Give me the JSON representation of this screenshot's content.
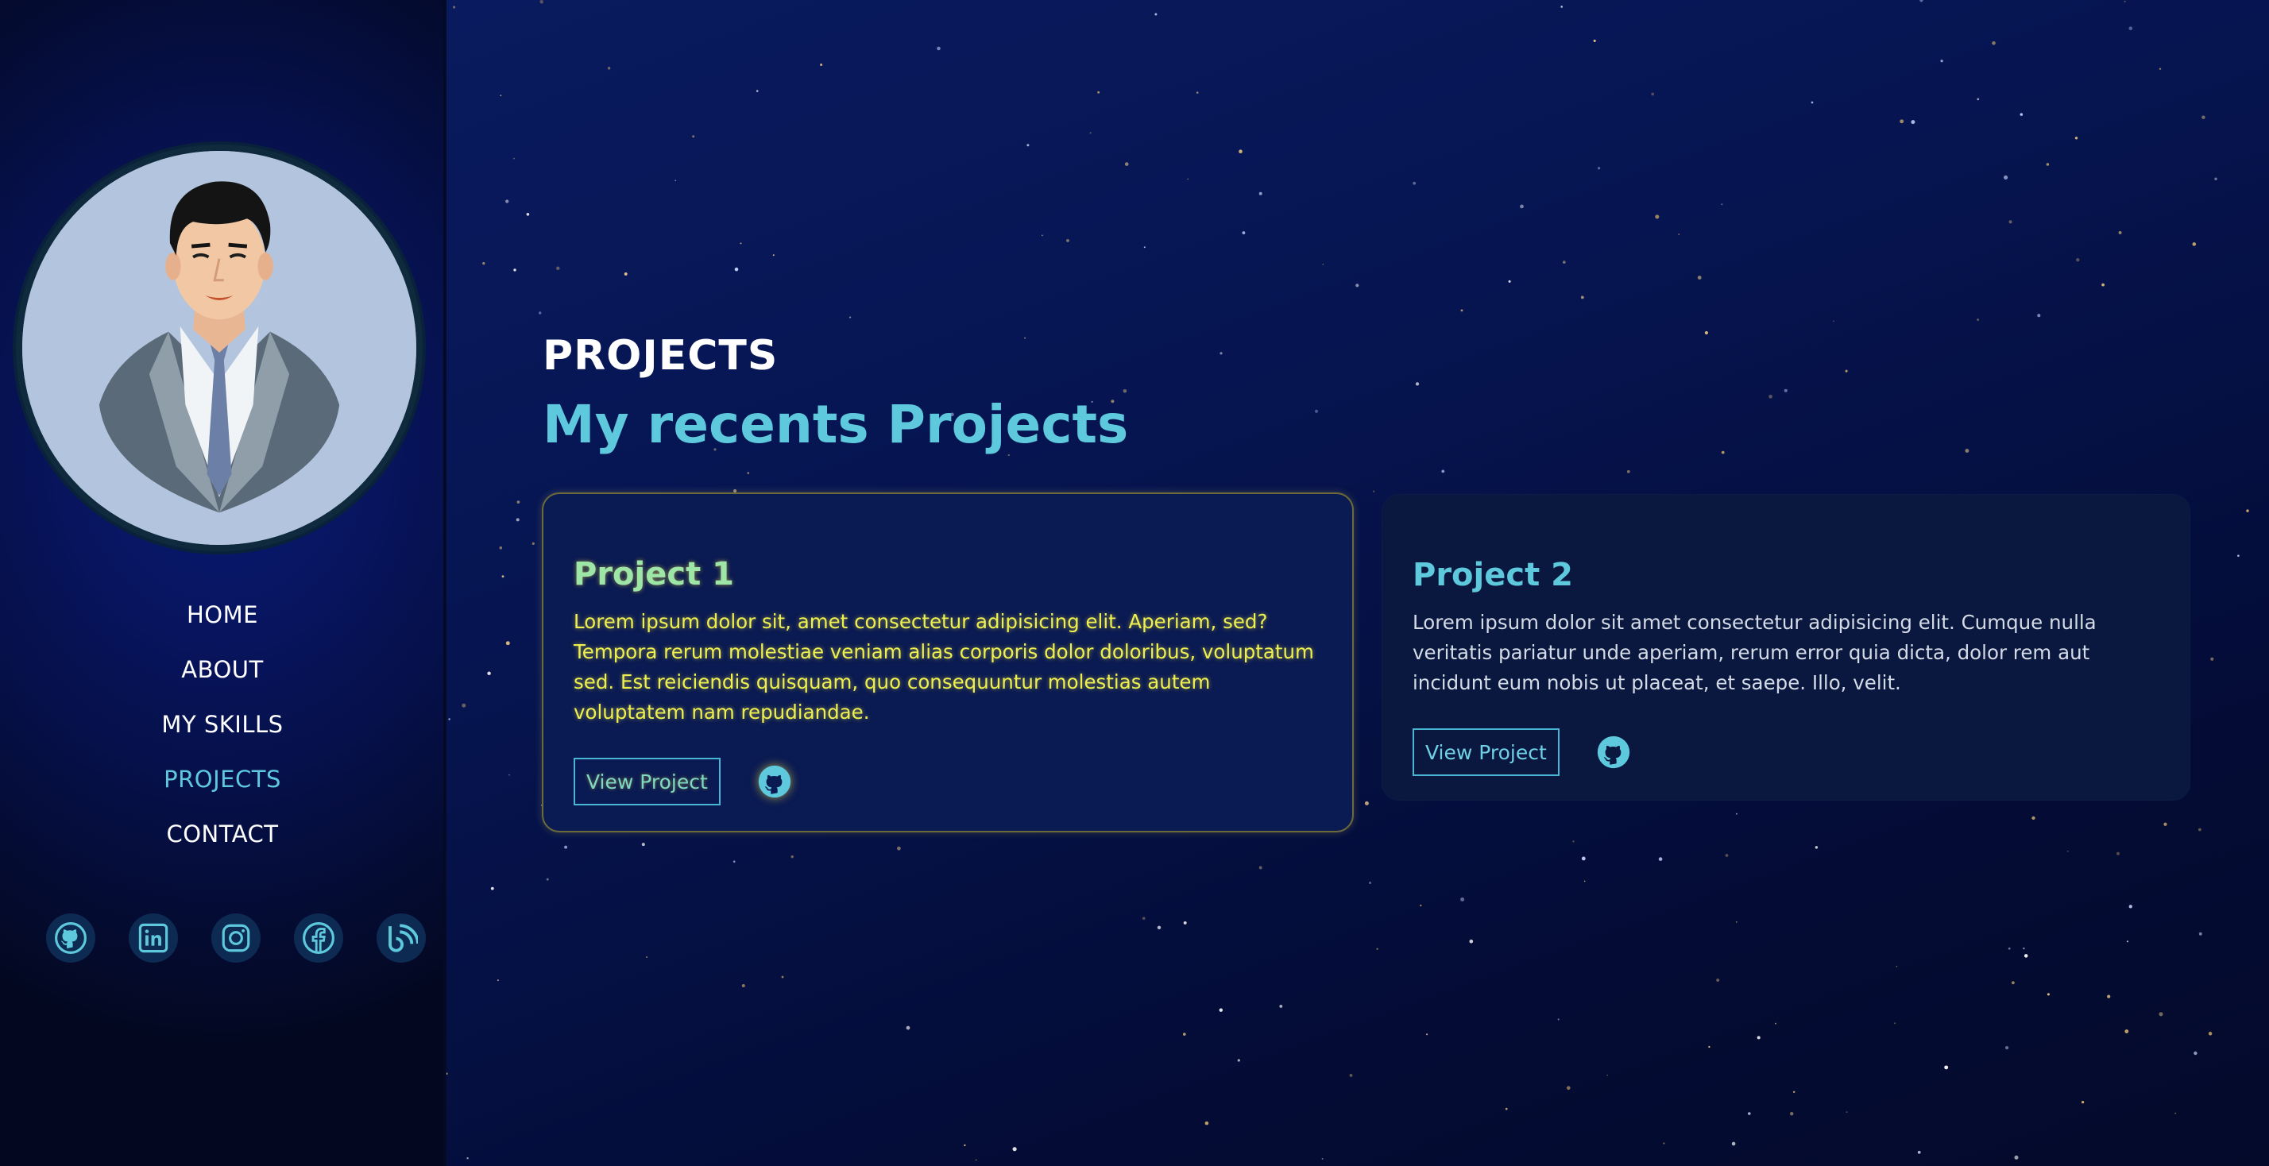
{
  "sidebar": {
    "nav": [
      {
        "label": "HOME"
      },
      {
        "label": "ABOUT"
      },
      {
        "label": "MY SKILLS"
      },
      {
        "label": "PROJECTS",
        "active": true
      },
      {
        "label": "CONTACT"
      }
    ],
    "socials": [
      {
        "icon": "github-icon"
      },
      {
        "icon": "linkedin-icon"
      },
      {
        "icon": "instagram-icon"
      },
      {
        "icon": "facebook-icon"
      },
      {
        "icon": "blog-icon"
      }
    ]
  },
  "main": {
    "kicker": "PROJECTS",
    "title": "My recents Projects",
    "projects": [
      {
        "title": "Project 1",
        "description": "Lorem ipsum dolor sit, amet consectetur adipisicing elit. Aperiam, sed? Tempora rerum molestiae veniam alias corporis dolor doloribus, voluptatum sed. Est reiciendis quisquam, quo consequuntur molestias autem voluptatem nam repudiandae.",
        "button_label": "View Project",
        "repo_icon": "github-icon"
      },
      {
        "title": "Project 2",
        "description": "Lorem ipsum dolor sit amet consectetur adipisicing elit. Cumque nulla veritatis pariatur unde aperiam, rerum error quia dicta, dolor rem aut incidunt eum nobis ut placeat, et saepe. Illo, velit.",
        "button_label": "View Project",
        "repo_icon": "github-icon"
      }
    ]
  },
  "colors": {
    "accent": "#5ec8dd",
    "highlight_text": "#eef050",
    "background": "#061552",
    "sidebar_background": "#06104a"
  }
}
